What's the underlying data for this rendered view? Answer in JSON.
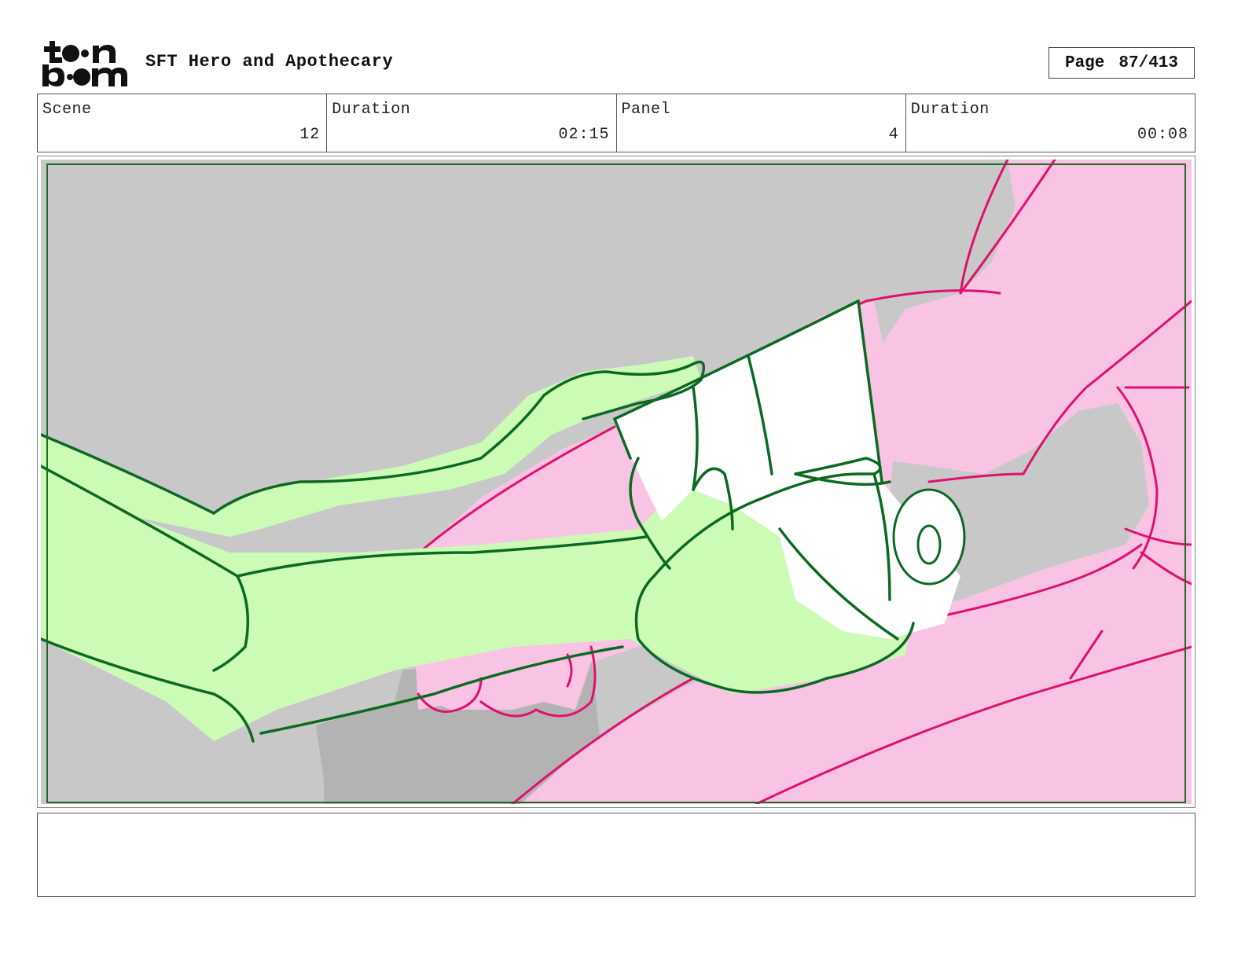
{
  "header": {
    "logo_text": "toon boom",
    "project_title": "SFT Hero and Apothecary",
    "page_label": "Page",
    "page_number": "87/413"
  },
  "info": {
    "scene_label": "Scene",
    "scene_value": "12",
    "scene_duration_label": "Duration",
    "scene_duration_value": "02:15",
    "panel_label": "Panel",
    "panel_value": "4",
    "panel_duration_label": "Duration",
    "panel_duration_value": "00:08"
  },
  "panel": {
    "colors": {
      "background": "#c8c8c8",
      "shadow": "#b3b3b3",
      "pink_fill": "#f9c4e4",
      "pink_line": "#e0106e",
      "green_fill": "#ccfbb6",
      "green_line": "#0b6a22",
      "cup": "#ffffff",
      "safe_frame": "#1e6b24"
    }
  },
  "notes": {
    "text": ""
  }
}
